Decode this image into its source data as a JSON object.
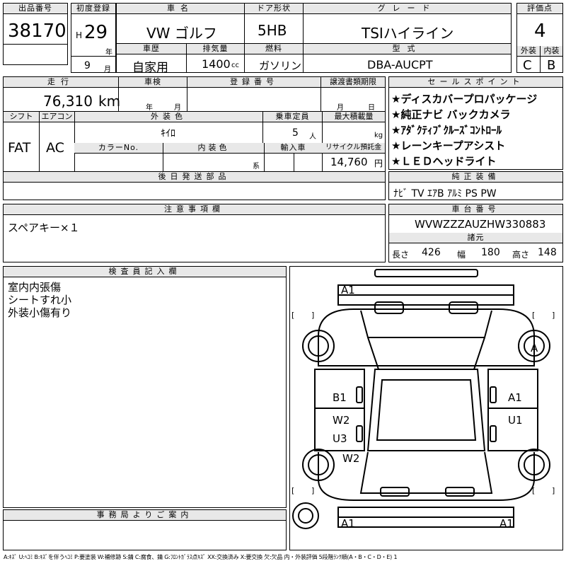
{
  "header_row": {
    "lot_no_label": "出品番号",
    "lot_no": "38170",
    "first_reg_label": "初度登録",
    "era": "H",
    "year": "29",
    "year_unit": "年",
    "month": "9",
    "month_unit": "月",
    "car_name_label": "車名",
    "car_name": "VW ゴルフ",
    "door_label": "ドア形状",
    "door": "5HB",
    "grade_label": "グレード",
    "grade": "TSIハイライン",
    "score_label": "評価点",
    "score": "4",
    "history_label": "車歴",
    "history": "自家用",
    "displacement_label": "排気量",
    "displacement": "1400",
    "displacement_unit": "cc",
    "fuel_label": "燃料",
    "fuel": "ガソリン",
    "model_label": "型式",
    "model": "DBA-AUCPT",
    "ext_label": "外装",
    "ext": "C",
    "int_label": "内装",
    "int": "B"
  },
  "row2": {
    "mileage_label": "走行",
    "mileage": "76,310",
    "mileage_unit": "km",
    "inspection_label": "車検",
    "ins_year_unit": "年",
    "ins_month_unit": "月",
    "reg_no_label": "登録番号",
    "transfer_label": "譲渡書類期限",
    "tr_month_unit": "月",
    "tr_day_unit": "日",
    "shift_label": "シフト",
    "shift": "FAT",
    "ac_label": "エアコン",
    "ac": "AC",
    "ext_color_label": "外装色",
    "ext_color": "ｷｲﾛ",
    "capacity_label": "乗車定員",
    "capacity": "5",
    "capacity_unit": "人",
    "max_load_label": "最大積載量",
    "max_load_unit": "kg",
    "color_no_label": "カラーNo.",
    "int_color_label": "内装色",
    "int_color_suffix": "系",
    "import_label": "輸入車",
    "recycle_label": "リサイクル預託金",
    "recycle": "14,760",
    "recycle_unit": "円",
    "later_parts_label": "後日発送部品"
  },
  "sales_points": {
    "label": "セールスポイント",
    "items": [
      "★ディスカバープロパッケージ",
      "★純正ナビ バックカメラ",
      "★ｱﾀﾞｸﾃｨﾌﾞｸﾙｰｽﾞｺﾝﾄﾛｰﾙ",
      "★レーンキープアシスト",
      "★ＬＥＤヘッドライト"
    ]
  },
  "equipment": {
    "label": "純正装備",
    "value": "ﾅﾋﾞ TV ｴｱB ｱﾙﾐ PS PW"
  },
  "notes": {
    "label": "注意事項欄",
    "value": "スペアキー×１"
  },
  "chassis": {
    "label": "車台番号",
    "value": "WVWZZZAUZHW330883"
  },
  "dims": {
    "label": "諸元",
    "length_label": "長さ",
    "length": "426",
    "width_label": "幅",
    "width": "180",
    "height_label": "高さ",
    "height": "148"
  },
  "inspector": {
    "label": "検査員記入欄",
    "lines": [
      "室内内張傷",
      "シートすれ小",
      "外装小傷有り"
    ]
  },
  "office": {
    "label": "事務局よりご案内"
  },
  "diagram_marks": [
    "A1",
    "A",
    "B1",
    "A1",
    "W2",
    "U1",
    "U3",
    "W2",
    "A1",
    "A1"
  ],
  "legend": "A:ｷｽﾞ U:ﾍｺﾐ B:ｷｽﾞを伴うﾍｺﾐ P:要塗装 W:補修跡 S:錆 C:腐食、錆 G:ﾌﾛﾝﾄｶﾞﾗｽ点ｷｽﾞ XX:交換済み X:要交換 欠:欠品 内・外装評価 5段階ﾗﾝｸ順(A・B・C・D・E) 1"
}
